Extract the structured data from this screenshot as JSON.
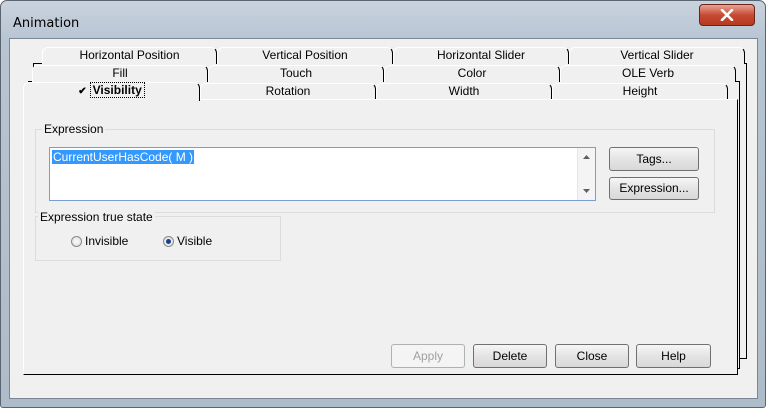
{
  "window": {
    "title": "Animation"
  },
  "tabs_row1": [
    "Horizontal Position",
    "Vertical Position",
    "Horizontal Slider",
    "Vertical Slider"
  ],
  "tabs_row2": [
    "Fill",
    "Touch",
    "Color",
    "OLE Verb"
  ],
  "tabs_row3": [
    "Visibility",
    "Rotation",
    "Width",
    "Height"
  ],
  "active_tab": {
    "label": "Visibility",
    "check": "✔"
  },
  "expression": {
    "group_label": "Expression",
    "value": "CurrentUserHasCode( M )",
    "tags_button": "Tags...",
    "expression_button": "Expression..."
  },
  "true_state": {
    "group_label": "Expression true state",
    "options": [
      "Invisible",
      "Visible"
    ],
    "selected": "Visible"
  },
  "footer": {
    "apply": "Apply",
    "delete": "Delete",
    "close": "Close",
    "help": "Help"
  },
  "icons": {
    "close": "close-x-icon",
    "scroll_up": "arrow-up-icon",
    "scroll_down": "arrow-down-icon",
    "check": "check-icon"
  }
}
